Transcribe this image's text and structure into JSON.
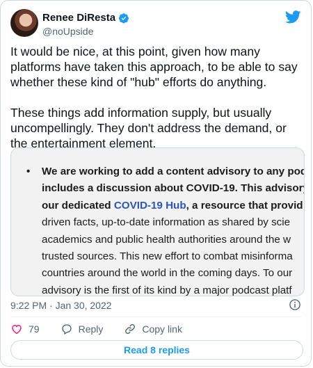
{
  "author": {
    "name": "Renee DiResta",
    "handle": "@noUpside"
  },
  "tweet": {
    "paragraph1": "It would be nice, at this point, given how many platforms have taken this approach, to be able to say whether these kind of \"hub\" efforts do anything.",
    "paragraph2": "These things add information supply, but usually uncompellingly. They don't address the demand, or the entertainment element."
  },
  "media": {
    "bullet": "•",
    "lines": [
      {
        "pre": "We are working to ",
        "bold": "add a content advisory to any pod",
        "hl": "",
        "post": ""
      },
      {
        "pre": "",
        "bold": "includes a discussion about COVID-19. This advisory",
        "hl": "",
        "post": ""
      },
      {
        "pre": "",
        "bold": "our dedicated ",
        "hl": "COVID-19 Hub",
        "post": ", a resource that provid"
      },
      {
        "pre": "driven facts, up-to-date information as shared by scie",
        "bold": "",
        "hl": "",
        "post": ""
      },
      {
        "pre": "academics and public health authorities around the w",
        "bold": "",
        "hl": "",
        "post": ""
      },
      {
        "pre": "trusted sources. This new effort to combat misinforma",
        "bold": "",
        "hl": "",
        "post": ""
      },
      {
        "pre": "countries around the world in the coming days. To our",
        "bold": "",
        "hl": "",
        "post": ""
      },
      {
        "pre": "advisory is the first of its kind by a major podcast platf",
        "bold": "",
        "hl": "",
        "post": ""
      }
    ]
  },
  "meta": {
    "timestamp": "9:22 PM · Jan 30, 2022"
  },
  "actions": {
    "like_count": "79",
    "reply_label": "Reply",
    "copy_label": "Copy link"
  },
  "read_replies": "Read 8 replies",
  "colors": {
    "accent": "#1d9bf0",
    "like": "#f91880",
    "secondary_text": "#536471",
    "hub_link": "#2b55b8"
  },
  "icons": [
    "verified-badge-icon",
    "twitter-bird-icon",
    "info-icon",
    "heart-icon",
    "reply-icon",
    "link-icon"
  ]
}
